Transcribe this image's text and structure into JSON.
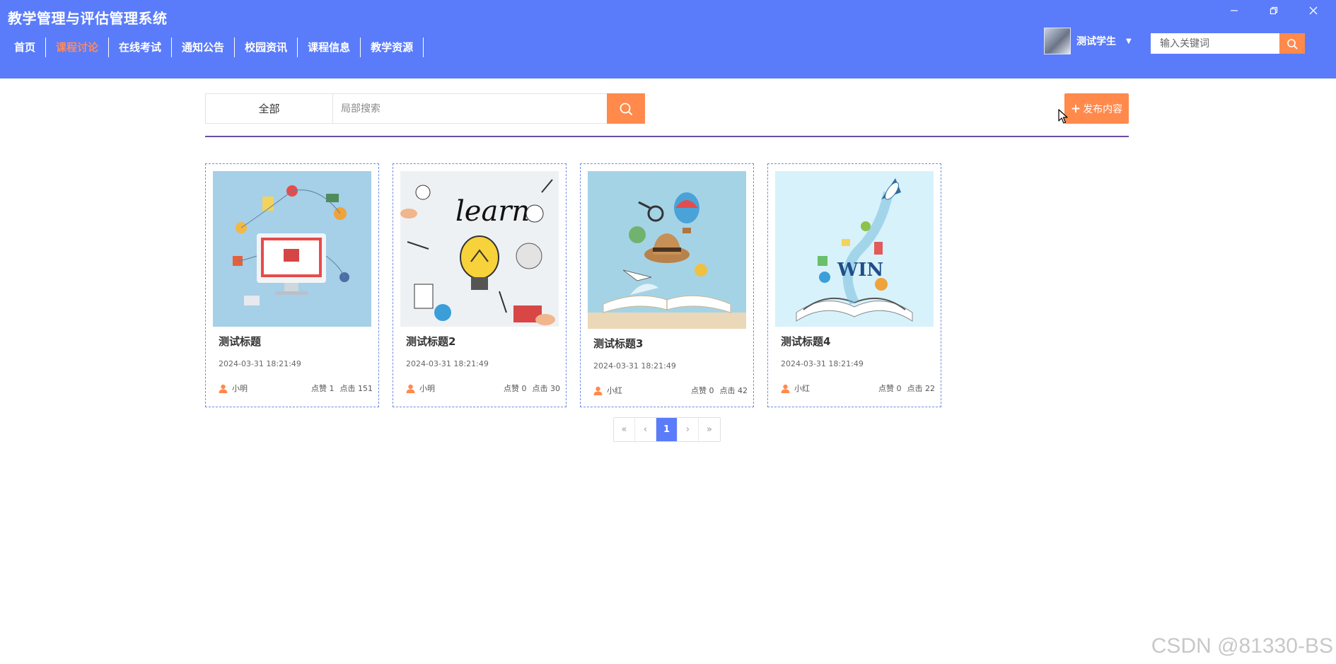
{
  "app": {
    "title": "教学管理与评估管理系统"
  },
  "nav": {
    "items": [
      {
        "label": "首页"
      },
      {
        "label": "课程讨论"
      },
      {
        "label": "在线考试"
      },
      {
        "label": "通知公告"
      },
      {
        "label": "校园资讯"
      },
      {
        "label": "课程信息"
      },
      {
        "label": "教学资源"
      }
    ],
    "active_index": 1
  },
  "user": {
    "name": "测试学生"
  },
  "top_search": {
    "placeholder": "输入关键词"
  },
  "filter": {
    "category": "全部",
    "placeholder": "局部搜索"
  },
  "publish_label": "发布内容",
  "cards": [
    {
      "title": "测试标题",
      "date": "2024-03-31 18:21:49",
      "author": "小明",
      "likes": "点赞 1",
      "clicks": "点击 151",
      "image": "computer-commerce"
    },
    {
      "title": "测试标题2",
      "date": "2024-03-31 18:21:49",
      "author": "小明",
      "likes": "点赞 0",
      "clicks": "点击 30",
      "image": "learn-bulb"
    },
    {
      "title": "测试标题3",
      "date": "2024-03-31 18:21:49",
      "author": "小红",
      "likes": "点赞 0",
      "clicks": "点击 42",
      "image": "book-travel"
    },
    {
      "title": "测试标题4",
      "date": "2024-03-31 18:21:49",
      "author": "小红",
      "likes": "点赞 0",
      "clicks": "点击 22",
      "image": "book-rocket"
    }
  ],
  "pagination": {
    "first": "«",
    "prev": "‹",
    "current": "1",
    "next": "›",
    "last": "»"
  },
  "watermark": "CSDN @81330-BS",
  "colors": {
    "header": "#5a7cfa",
    "accent": "#ff8a4c",
    "active_nav": "#ff8a5b",
    "divider": "#6a4da8"
  }
}
